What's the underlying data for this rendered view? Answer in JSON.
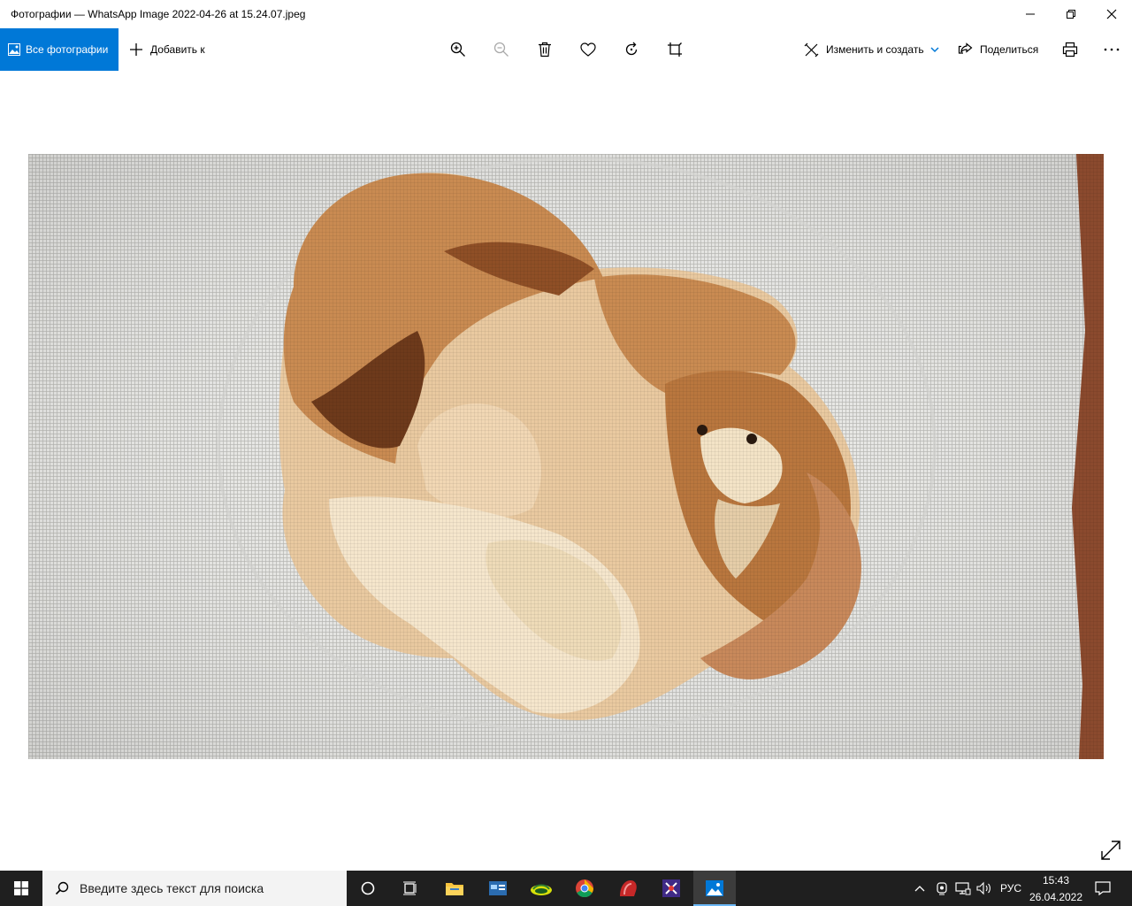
{
  "window": {
    "title": "Фотографии — WhatsApp Image 2022-04-26 at 15.24.07.jpeg"
  },
  "toolbar": {
    "all_photos_label": "Все фотографии",
    "add_to_label": "Добавить к",
    "edit_create_label": "Изменить и создать",
    "share_label": "Поделиться"
  },
  "photo": {
    "subject": "cross-stitch embroidery: child hugging a puppy"
  },
  "taskbar": {
    "search_placeholder": "Введите здесь текст для поиска",
    "language": "РУС",
    "time": "15:43",
    "date": "26.04.2022"
  },
  "colors": {
    "accent": "#0078d7",
    "taskbar": "#1f1f1f"
  }
}
